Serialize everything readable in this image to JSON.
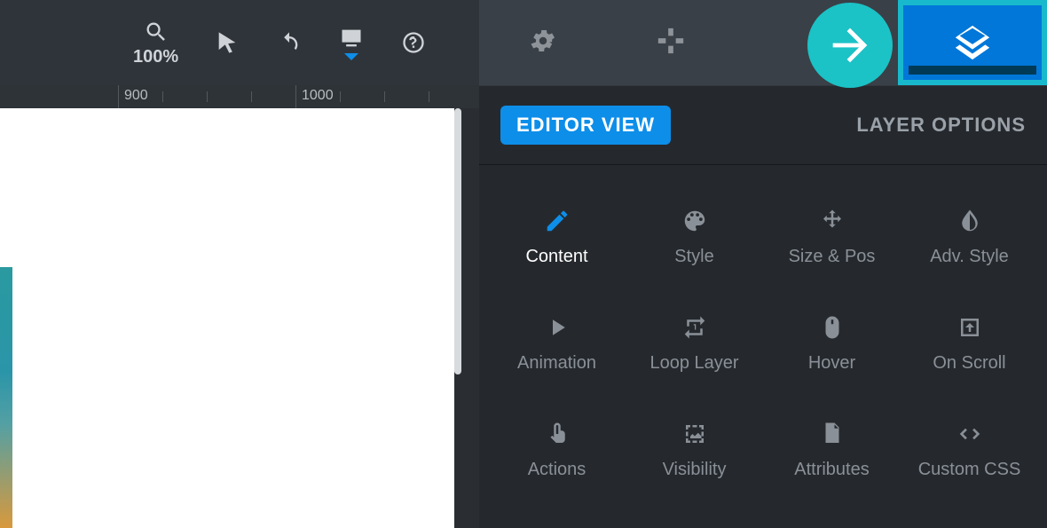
{
  "toolbar": {
    "zoom_label": "100%"
  },
  "ruler": {
    "labels": [
      {
        "value": "900",
        "pos": 140
      },
      {
        "value": "1000",
        "pos": 340
      }
    ]
  },
  "panel": {
    "editor_view_label": "EDITOR VIEW",
    "layer_options_label": "LAYER OPTIONS"
  },
  "sections": [
    {
      "name": "content",
      "label": "Content",
      "icon": "pencil",
      "active": true
    },
    {
      "name": "style",
      "label": "Style",
      "icon": "palette",
      "active": false
    },
    {
      "name": "sizepos",
      "label": "Size & Pos",
      "icon": "move",
      "active": false
    },
    {
      "name": "advstyle",
      "label": "Adv. Style",
      "icon": "invert",
      "active": false
    },
    {
      "name": "animation",
      "label": "Animation",
      "icon": "play",
      "active": false
    },
    {
      "name": "looplayer",
      "label": "Loop Layer",
      "icon": "repeat-one",
      "active": false
    },
    {
      "name": "hover",
      "label": "Hover",
      "icon": "mouse",
      "active": false
    },
    {
      "name": "onscroll",
      "label": "On Scroll",
      "icon": "download-box",
      "active": false
    },
    {
      "name": "actions",
      "label": "Actions",
      "icon": "touch",
      "active": false
    },
    {
      "name": "visibility",
      "label": "Visibility",
      "icon": "image-dashed",
      "active": false
    },
    {
      "name": "attributes",
      "label": "Attributes",
      "icon": "file",
      "active": false
    },
    {
      "name": "customcss",
      "label": "Custom CSS",
      "icon": "code",
      "active": false
    }
  ]
}
